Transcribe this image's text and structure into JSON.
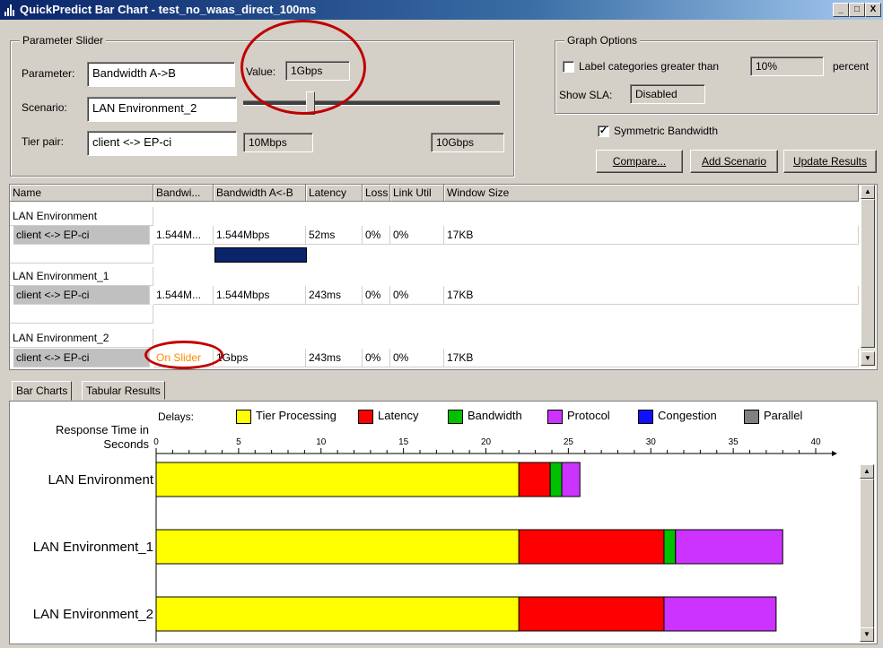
{
  "window": {
    "title": "QuickPredict Bar Chart - test_no_waas_direct_100ms",
    "min_label": "_",
    "max_label": "□",
    "close_label": "X"
  },
  "param_slider": {
    "group_title": "Parameter Slider",
    "parameter_label": "Parameter:",
    "parameter_value": "Bandwidth A->B",
    "scenario_label": "Scenario:",
    "scenario_value": "LAN Environment_2",
    "tierpair_label": "Tier pair:",
    "tierpair_value": "client <-> EP-ci",
    "value_label": "Value:",
    "value": "1Gbps",
    "slider_position": 0.25,
    "min_value": "10Mbps",
    "max_value": "10Gbps"
  },
  "graph_options": {
    "group_title": "Graph Options",
    "label_categories_label": "Label categories greater than",
    "label_categories_checked": false,
    "label_threshold": "10%",
    "percent_label": "percent",
    "show_sla_label": "Show SLA:",
    "show_sla_value": "Disabled",
    "symmetric_bandwidth_label": "Symmetric Bandwidth",
    "symmetric_bandwidth_checked": true,
    "compare_button": "Compare...",
    "add_scenario_button": "Add Scenario",
    "update_results_button": "Update Results"
  },
  "table": {
    "columns": [
      "Name",
      "Bandwi...",
      "Bandwidth A<-B",
      "Latency",
      "Loss",
      "Link Util",
      "Window Size"
    ],
    "rows": [
      {
        "type": "group",
        "name": "LAN Environment"
      },
      {
        "type": "data",
        "cells": [
          "client <-> EP-ci",
          "1.544M...",
          "1.544Mbps",
          "52ms",
          "0%",
          "0%",
          "17KB"
        ]
      },
      {
        "type": "blank"
      },
      {
        "type": "group",
        "name": "LAN Environment_1"
      },
      {
        "type": "data",
        "cells": [
          "client <-> EP-ci",
          "1.544M...",
          "1.544Mbps",
          "243ms",
          "0%",
          "0%",
          "17KB"
        ]
      },
      {
        "type": "blank"
      },
      {
        "type": "group",
        "name": "LAN Environment_2"
      },
      {
        "type": "data",
        "cells": [
          "client <-> EP-ci",
          "On Slider",
          "1Gbps",
          "243ms",
          "0%",
          "0%",
          "17KB"
        ]
      }
    ]
  },
  "tabs": {
    "bar_charts": "Bar Charts",
    "tabular_results": "Tabular Results"
  },
  "colors": {
    "tier_processing": "#ffff00",
    "latency": "#ff0000",
    "bandwidth": "#00c000",
    "protocol": "#cc33ff",
    "congestion": "#1010ff",
    "parallel": "#808080",
    "highlight": "#c00000",
    "on_slider": "#ff8c00"
  },
  "chart_data": {
    "type": "bar",
    "orientation": "horizontal",
    "stacked": true,
    "delays_label": "Delays:",
    "xlabel": "Response Time in Seconds",
    "xlim": [
      0,
      40
    ],
    "xticks": [
      "0",
      "5",
      "10",
      "15",
      "20",
      "25",
      "30",
      "35",
      "40"
    ],
    "categories": [
      "LAN Environment",
      "LAN Environment_1",
      "LAN Environment_2"
    ],
    "series": [
      {
        "name": "Tier Processing",
        "values": [
          22.0,
          22.0,
          22.0
        ]
      },
      {
        "name": "Latency",
        "values": [
          1.9,
          8.8,
          8.8
        ]
      },
      {
        "name": "Bandwidth",
        "values": [
          0.7,
          0.7,
          0.0
        ]
      },
      {
        "name": "Protocol",
        "values": [
          1.1,
          6.5,
          6.8
        ]
      },
      {
        "name": "Congestion",
        "values": [
          0,
          0,
          0
        ]
      },
      {
        "name": "Parallel",
        "values": [
          0,
          0,
          0
        ]
      }
    ]
  }
}
